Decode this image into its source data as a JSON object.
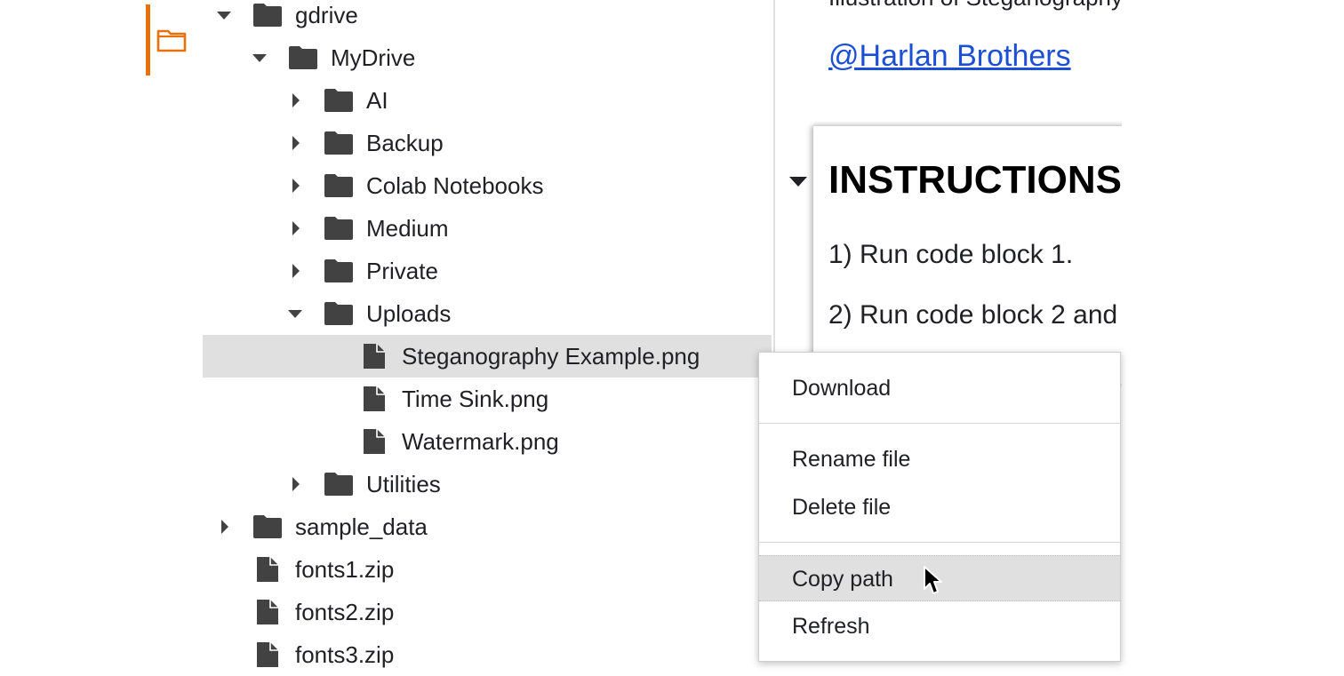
{
  "tree": {
    "items": [
      {
        "name": "gdrive",
        "type": "folder",
        "state": "expanded",
        "level": 0
      },
      {
        "name": "MyDrive",
        "type": "folder",
        "state": "expanded",
        "level": 1
      },
      {
        "name": "AI",
        "type": "folder",
        "state": "collapsed",
        "level": 2
      },
      {
        "name": "Backup",
        "type": "folder",
        "state": "collapsed",
        "level": 2
      },
      {
        "name": "Colab Notebooks",
        "type": "folder",
        "state": "collapsed",
        "level": 2
      },
      {
        "name": "Medium",
        "type": "folder",
        "state": "collapsed",
        "level": 2
      },
      {
        "name": "Private",
        "type": "folder",
        "state": "collapsed",
        "level": 2
      },
      {
        "name": "Uploads",
        "type": "folder",
        "state": "expanded",
        "level": 2
      },
      {
        "name": "Steganography Example.png",
        "type": "file",
        "level": 3,
        "selected": true
      },
      {
        "name": "Time Sink.png",
        "type": "file",
        "level": 3
      },
      {
        "name": "Watermark.png",
        "type": "file",
        "level": 3
      },
      {
        "name": "Utilities",
        "type": "folder",
        "state": "collapsed",
        "level": 2
      },
      {
        "name": "sample_data",
        "type": "folder",
        "state": "collapsed",
        "level": 0
      },
      {
        "name": "fonts1.zip",
        "type": "file",
        "level": 0
      },
      {
        "name": "fonts2.zip",
        "type": "file",
        "level": 0
      },
      {
        "name": "fonts3.zip",
        "type": "file",
        "level": 0
      }
    ]
  },
  "notebook": {
    "author_link": "@Harlan Brothers",
    "section_title": "INSTRUCTIONS",
    "step1": "1) Run code block 1.",
    "step2": "2) Run code block 2 and",
    "top_text": "Illustration of Steganography"
  },
  "context_menu": {
    "download": "Download",
    "rename": "Rename file",
    "delete": "Delete file",
    "copy_path": "Copy path",
    "refresh": "Refresh"
  },
  "colors": {
    "accent": "#e8710a",
    "link": "#1a4fd6",
    "selection": "#e0e0e0",
    "icon": "#424242"
  },
  "icons": {
    "rail": "folder-outline-icon",
    "folder": "folder-icon",
    "file": "file-icon",
    "expanded": "caret-down-icon",
    "collapsed": "caret-right-icon",
    "pointer": "mouse-pointer-icon"
  }
}
